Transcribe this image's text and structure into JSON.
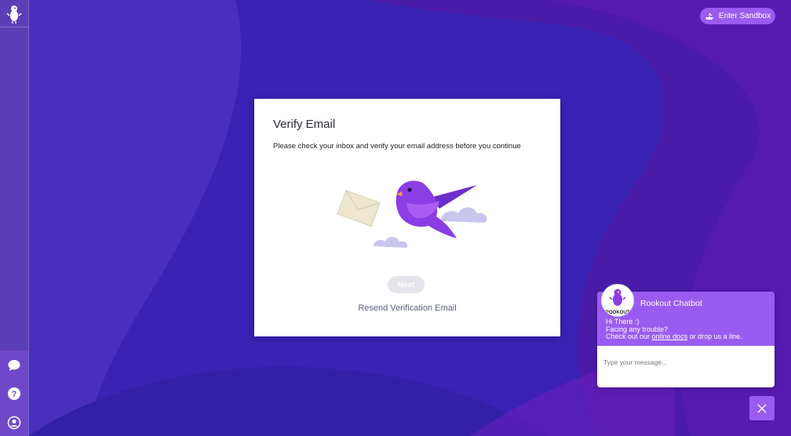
{
  "header": {
    "sandbox_label": "Enter Sandbox"
  },
  "sidebar": {
    "logo_icon": "rookout-bird-logo-icon",
    "bottom_icons": [
      "chat-bubble-icon",
      "help-icon",
      "user-icon"
    ]
  },
  "modal": {
    "title": "Verify Email",
    "description": "Please check your inbox and verify your email address before you continue",
    "illustration": "bird-carrying-envelope",
    "next_label": "Next",
    "resend_label": "Resend Verification Email"
  },
  "chatbot": {
    "title": "Rookout Chatbot",
    "avatar_text": "ROOKOUT",
    "greeting": "Hi There :)",
    "line2": "Facing any trouble?",
    "line3_prefix": "Check out our ",
    "docs_link": "online docs",
    "line3_suffix": " or drop us a line.",
    "input_placeholder": "Type your message..."
  },
  "colors": {
    "accent": "#9a5cf0",
    "background": "#3a1fb0",
    "sidebar": "#5b3fb8"
  }
}
